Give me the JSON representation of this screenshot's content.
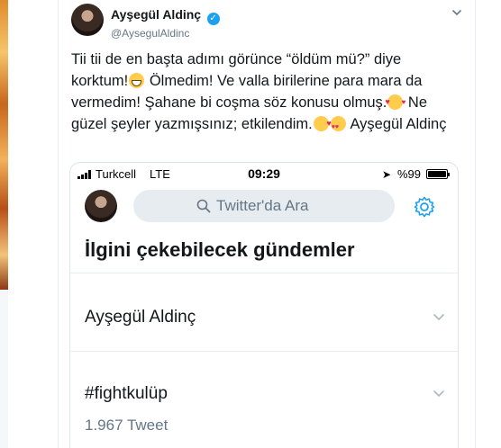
{
  "tweet": {
    "author_name": "Ayşegül Aldinç",
    "author_handle": "@AysegulAldinc",
    "text_parts": {
      "p1": "Tii tii de en başta adımı görünce “öldüm mü?” diye korktum!",
      "p2": " Ölmedim! Ve valla birilerine para mara da vermedim! Şahane bi coşma  söz konusu olmuş.",
      "p3": " Ne güzel şeyler yazmışsınız; etkilendim.",
      "p4": " Ayşegül Aldinç"
    },
    "icons": {
      "emoji1": "grinning-face-icon",
      "emoji2": "smiling-face-with-hearts-icon",
      "emoji3": "face-blowing-kiss-icon",
      "emoji4": "heart-eyes-icon"
    }
  },
  "screenshot": {
    "status_bar": {
      "carrier": "Turkcell",
      "network": "LTE",
      "time": "09:29",
      "battery": "%99",
      "battery_level": 0.99
    },
    "search": {
      "placeholder": "Twitter'da Ara"
    },
    "trends_heading": "İlgini çekebilecek gündemler",
    "trends": [
      {
        "name": "Ayşegül Aldinç",
        "count": ""
      },
      {
        "name": "#fightkulüp",
        "count": "1.967 Tweet"
      }
    ]
  },
  "colors": {
    "accent": "#1da1f2",
    "text": "#14171a",
    "secondary": "#657786"
  }
}
